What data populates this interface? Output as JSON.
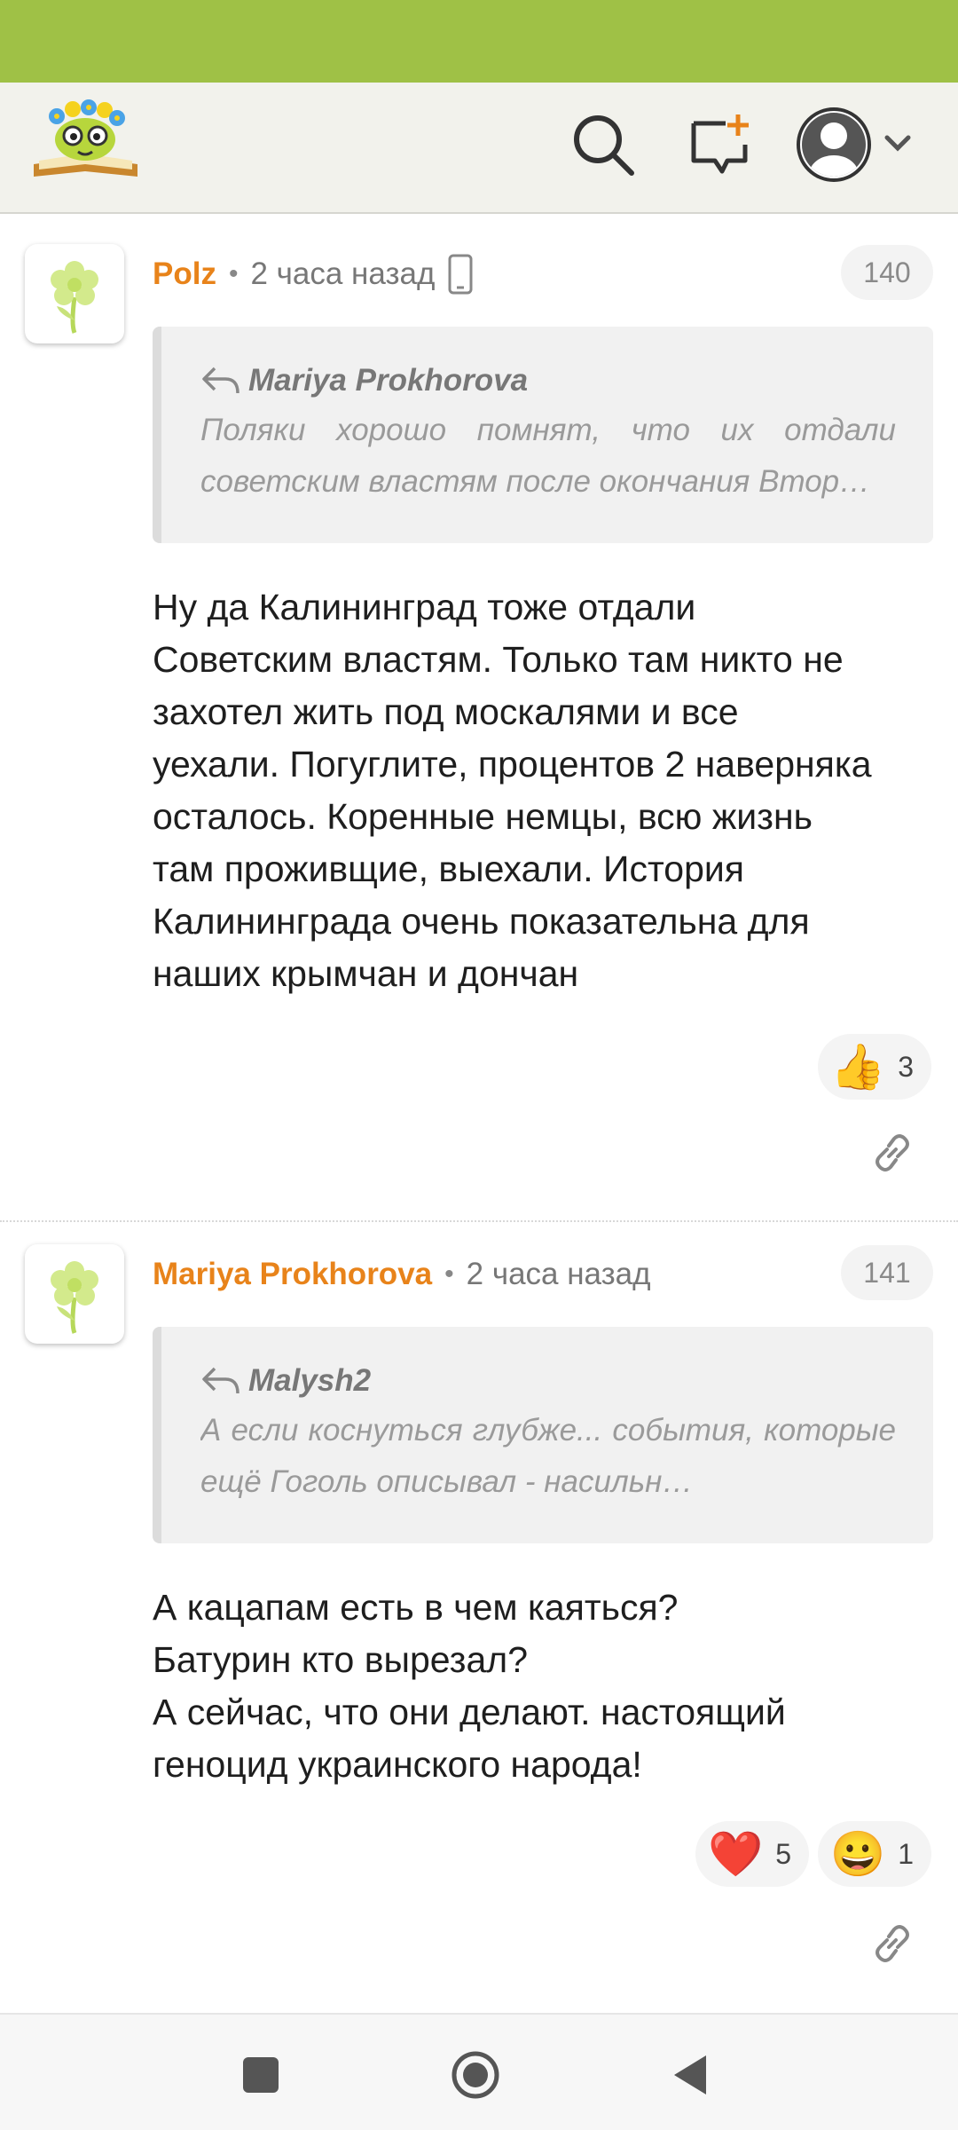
{
  "comments": [
    {
      "author": "Polz",
      "time": "2 часа назад",
      "number": "140",
      "quote_author": "Mariya Prokhorova",
      "quote_text": "Поляки хорошо помнят, что их отдали советским властям после окончания Втор…",
      "body_lines": [
        "Ну да Калининград тоже отдали",
        "Советским властям. Только там никто не",
        "захотел жить под москалями и все",
        "уехали. Погуглите, процентов 2 наверняка",
        "осталось. Коренные немцы, всю жизнь",
        "там проживщие, выехали. История",
        "Калининграда очень показательна для",
        "наших крымчан и дончан"
      ],
      "reactions": [
        {
          "emoji": "👍",
          "count": "3"
        }
      ]
    },
    {
      "author": "Mariya Prokhorova",
      "time": "2 часа назад",
      "number": "141",
      "quote_author": "Malysh2",
      "quote_text": "А если коснуться глубже... события, которые ещё Гоголь описывал - насильн…",
      "body_lines": [
        "А кацапам есть в чем каяться?",
        "Батурин кто вырезал?",
        "А сейчас, что они делают. настоящий",
        "геноцид украинского народа!"
      ],
      "reactions": [
        {
          "emoji": "❤️",
          "count": "5"
        },
        {
          "emoji": "😀",
          "count": "1"
        }
      ]
    }
  ],
  "colors": {
    "status_bar": "#9fc146",
    "author": "#e8831a"
  }
}
